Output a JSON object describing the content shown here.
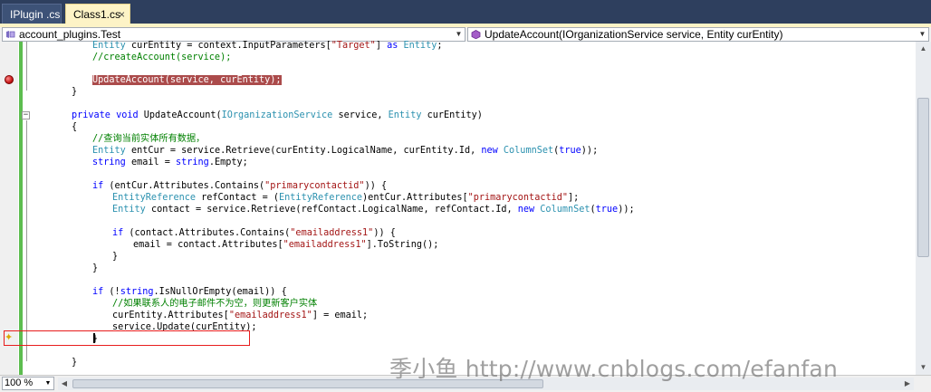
{
  "tabs": [
    {
      "label": "IPlugin .cs",
      "active": false
    },
    {
      "label": "Class1.cs",
      "active": true,
      "close": "×"
    }
  ],
  "navbar": {
    "left_value": "account_plugins.Test",
    "right_value": "UpdateAccount(IOrganizationService service, Entity curEntity)"
  },
  "code": {
    "l1": {
      "t1": "Entity",
      "t2": " curEntity = context.InputParameters[",
      "t3": "\"Target\"",
      "t4": "] ",
      "t5": "as",
      "t6": " ",
      "t7": "Entity",
      "t8": ";"
    },
    "l2": {
      "t1": "//createAccount(service);"
    },
    "l3": {
      "t1": "UpdateAccount(service, curEntity);"
    },
    "l4": {
      "t1": "}"
    },
    "l5": {
      "t1": "private",
      "t2": " ",
      "t3": "void",
      "t4": " UpdateAccount(",
      "t5": "IOrganizationService",
      "t6": " service, ",
      "t7": "Entity",
      "t8": " curEntity)"
    },
    "l6": {
      "t1": "{"
    },
    "l7": {
      "t1": "//查询当前实体所有数据，"
    },
    "l8": {
      "t1": "Entity",
      "t2": " entCur = service.Retrieve(curEntity.LogicalName, curEntity.Id, ",
      "t3": "new",
      "t4": " ",
      "t5": "ColumnSet",
      "t6": "(",
      "t7": "true",
      "t8": "));"
    },
    "l9": {
      "t1": "string",
      "t2": " email = ",
      "t3": "string",
      "t4": ".Empty;"
    },
    "l10": {
      "t1": "if",
      "t2": " (entCur.Attributes.Contains(",
      "t3": "\"primarycontactid\"",
      "t4": ")) {"
    },
    "l11": {
      "t1": "EntityReference",
      "t2": " refContact = (",
      "t3": "EntityReference",
      "t4": ")entCur.Attributes[",
      "t5": "\"primarycontactid\"",
      "t6": "];"
    },
    "l12": {
      "t1": "Entity",
      "t2": " contact = service.Retrieve(refContact.LogicalName, refContact.Id, ",
      "t3": "new",
      "t4": " ",
      "t5": "ColumnSet",
      "t6": "(",
      "t7": "true",
      "t8": "));"
    },
    "l13": {
      "t1": "if",
      "t2": " (contact.Attributes.Contains(",
      "t3": "\"emailaddress1\"",
      "t4": ")) {"
    },
    "l14": {
      "t1": "email = contact.Attributes[",
      "t2": "\"emailaddress1\"",
      "t3": "].ToString();"
    },
    "l15": {
      "t1": "}"
    },
    "l16": {
      "t1": "}"
    },
    "l17": {
      "t1": "if",
      "t2": " (!",
      "t3": "string",
      "t4": ".IsNullOrEmpty(email)) {"
    },
    "l18": {
      "t1": "//如果联系人的电子邮件不为空，则更新客户实体"
    },
    "l19": {
      "t1": "curEntity.Attributes[",
      "t2": "\"emailaddress1\"",
      "t3": "] = email;"
    },
    "l20": {
      "t1": "service.Update(curEntity);"
    },
    "l21": {
      "t1": "}"
    },
    "l22": {
      "t1": "}"
    }
  },
  "zoom": "100 %",
  "watermark": "季小鱼 http://www.cnblogs.com/efanfan",
  "colors": {
    "keyword": "#0000ff",
    "type": "#2b91af",
    "string": "#a31515",
    "comment": "#008000",
    "breakpoint_highlight": "#ab4b4b",
    "change_bar": "#5cbd4f",
    "annotation_box": "#e81c1c"
  },
  "icons": {
    "breakpoint": "breakpoint-icon",
    "smart_tag": "smart-tag-icon",
    "namespace": "namespace-icon",
    "method": "method-icon"
  }
}
